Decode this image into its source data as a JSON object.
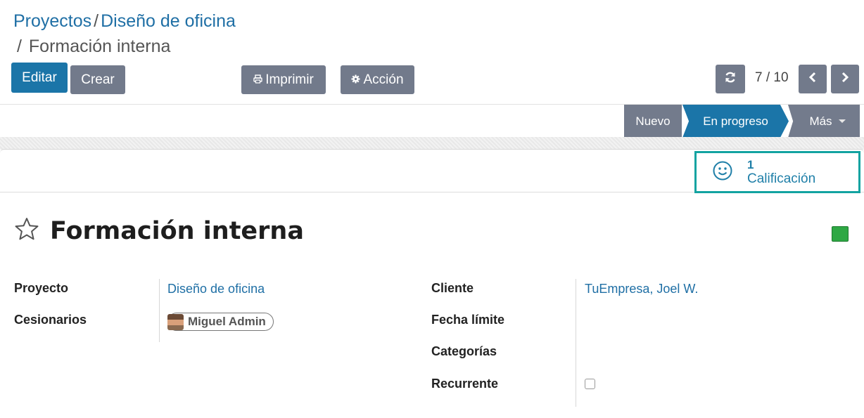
{
  "breadcrumb": {
    "items": [
      "Proyectos",
      "Diseño de oficina",
      "Formación interna"
    ],
    "separator": "/"
  },
  "toolbar": {
    "edit_label": "Editar",
    "create_label": "Crear",
    "print_label": "Imprimir",
    "action_label": "Acción"
  },
  "pager": {
    "value": "7 / 10"
  },
  "stages": {
    "nuevo": "Nuevo",
    "in_progress": "En progreso",
    "more": "Más"
  },
  "smart_button": {
    "count": "1",
    "label": "Calificación"
  },
  "record": {
    "title": "Formación interna",
    "color": "#2ea844"
  },
  "fields": {
    "project_label": "Proyecto",
    "project_value": "Diseño de oficina",
    "assignees_label": "Cesionarios",
    "assignee_name": "Miguel Admin",
    "customer_label": "Cliente",
    "customer_value": "TuEmpresa, Joel W.",
    "deadline_label": "Fecha límite",
    "tags_label": "Categorías",
    "recurring_label": "Recurrente"
  },
  "colors": {
    "primary": "#1b75a8",
    "secondary": "#727a8b",
    "highlight_border": "#13a3a1",
    "link": "#1f6fa5"
  }
}
